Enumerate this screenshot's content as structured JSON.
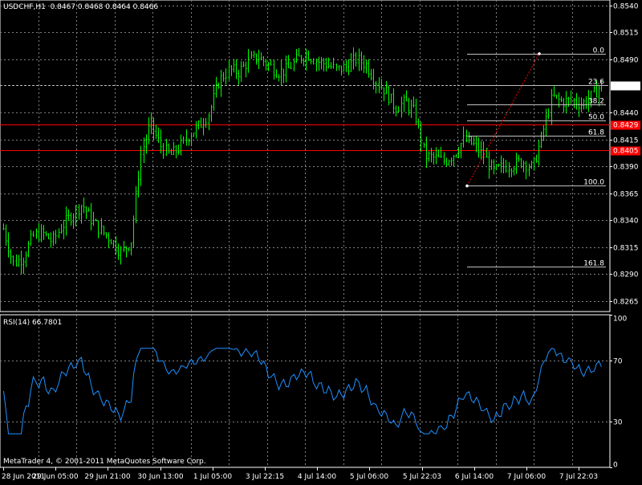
{
  "header": {
    "symbol": "USDCHF,H1",
    "ohlc": "0.8467 0.8468 0.8464 0.8466"
  },
  "rsi": {
    "title": "RSI(14) 66.7801",
    "levels": [
      30,
      70
    ],
    "range": [
      0,
      100
    ],
    "tick_labels": [
      "100",
      "70",
      "30",
      "0"
    ]
  },
  "copyright": "MetaTrader 4, © 2001-2011 MetaQuotes Software Corp.",
  "colors": {
    "background": "#000000",
    "candle": "#00ff00",
    "grid": "#808080",
    "rsi_line": "#1e90ff",
    "hline_red": "#ff0000",
    "fib": "#c0c0c0",
    "trendline": "#ff0000"
  },
  "chart_data": {
    "type": "line",
    "title": "USDCHF,H1",
    "price_axis": {
      "ylim": [
        0.8255,
        0.8545
      ],
      "tick_labels": [
        "0.8540",
        "0.8515",
        "0.8490",
        "0.8466",
        "0.8440",
        "0.8429",
        "0.8415",
        "0.8405",
        "0.8390",
        "0.8365",
        "0.8340",
        "0.8315",
        "0.8290",
        "0.8265"
      ]
    },
    "x_tick_labels": [
      "28 Jun 2011",
      "29 Jun 05:00",
      "29 Jun 21:00",
      "30 Jun 13:00",
      "1 Jul 05:00",
      "3 Jul 22:15",
      "4 Jul 14:00",
      "5 Jul 06:00",
      "5 Jul 22:03",
      "6 Jul 14:00",
      "7 Jul 06:00",
      "7 Jul 22:03"
    ],
    "series": [
      {
        "values": [
          0.8332,
          0.83,
          0.8305,
          0.8325,
          0.8328,
          0.832,
          0.8335,
          0.8345,
          0.8355,
          0.834,
          0.833,
          0.8322,
          0.831,
          0.832,
          0.84,
          0.843,
          0.841,
          0.84,
          0.8408,
          0.842,
          0.8428,
          0.844,
          0.847,
          0.848,
          0.8478,
          0.8488,
          0.8492,
          0.8485,
          0.8478,
          0.848,
          0.849,
          0.8495,
          0.8488,
          0.8485,
          0.848,
          0.8483,
          0.849,
          0.8485,
          0.847,
          0.846,
          0.8445,
          0.845,
          0.844,
          0.84,
          0.8398,
          0.8395,
          0.8402,
          0.8415,
          0.841,
          0.84,
          0.8385,
          0.839,
          0.8392,
          0.8395,
          0.8388,
          0.842,
          0.8455,
          0.845,
          0.8452,
          0.8448,
          0.8455,
          0.8466
        ]
      }
    ]
  },
  "fibonacci": {
    "levels": [
      "0.0",
      "23.6",
      "38.2",
      "50.0",
      "61.8",
      "100.0",
      "161.8"
    ],
    "values": [
      0.8495,
      0.8466,
      0.8448,
      0.8433,
      0.8419,
      0.8372,
      0.8297
    ]
  },
  "price_markers": [
    {
      "label": "0.8466",
      "value": 0.8466,
      "style": "current"
    },
    {
      "label": "0.8429",
      "value": 0.8429,
      "style": "red"
    },
    {
      "label": "0.8405",
      "value": 0.8405,
      "style": "red"
    }
  ]
}
